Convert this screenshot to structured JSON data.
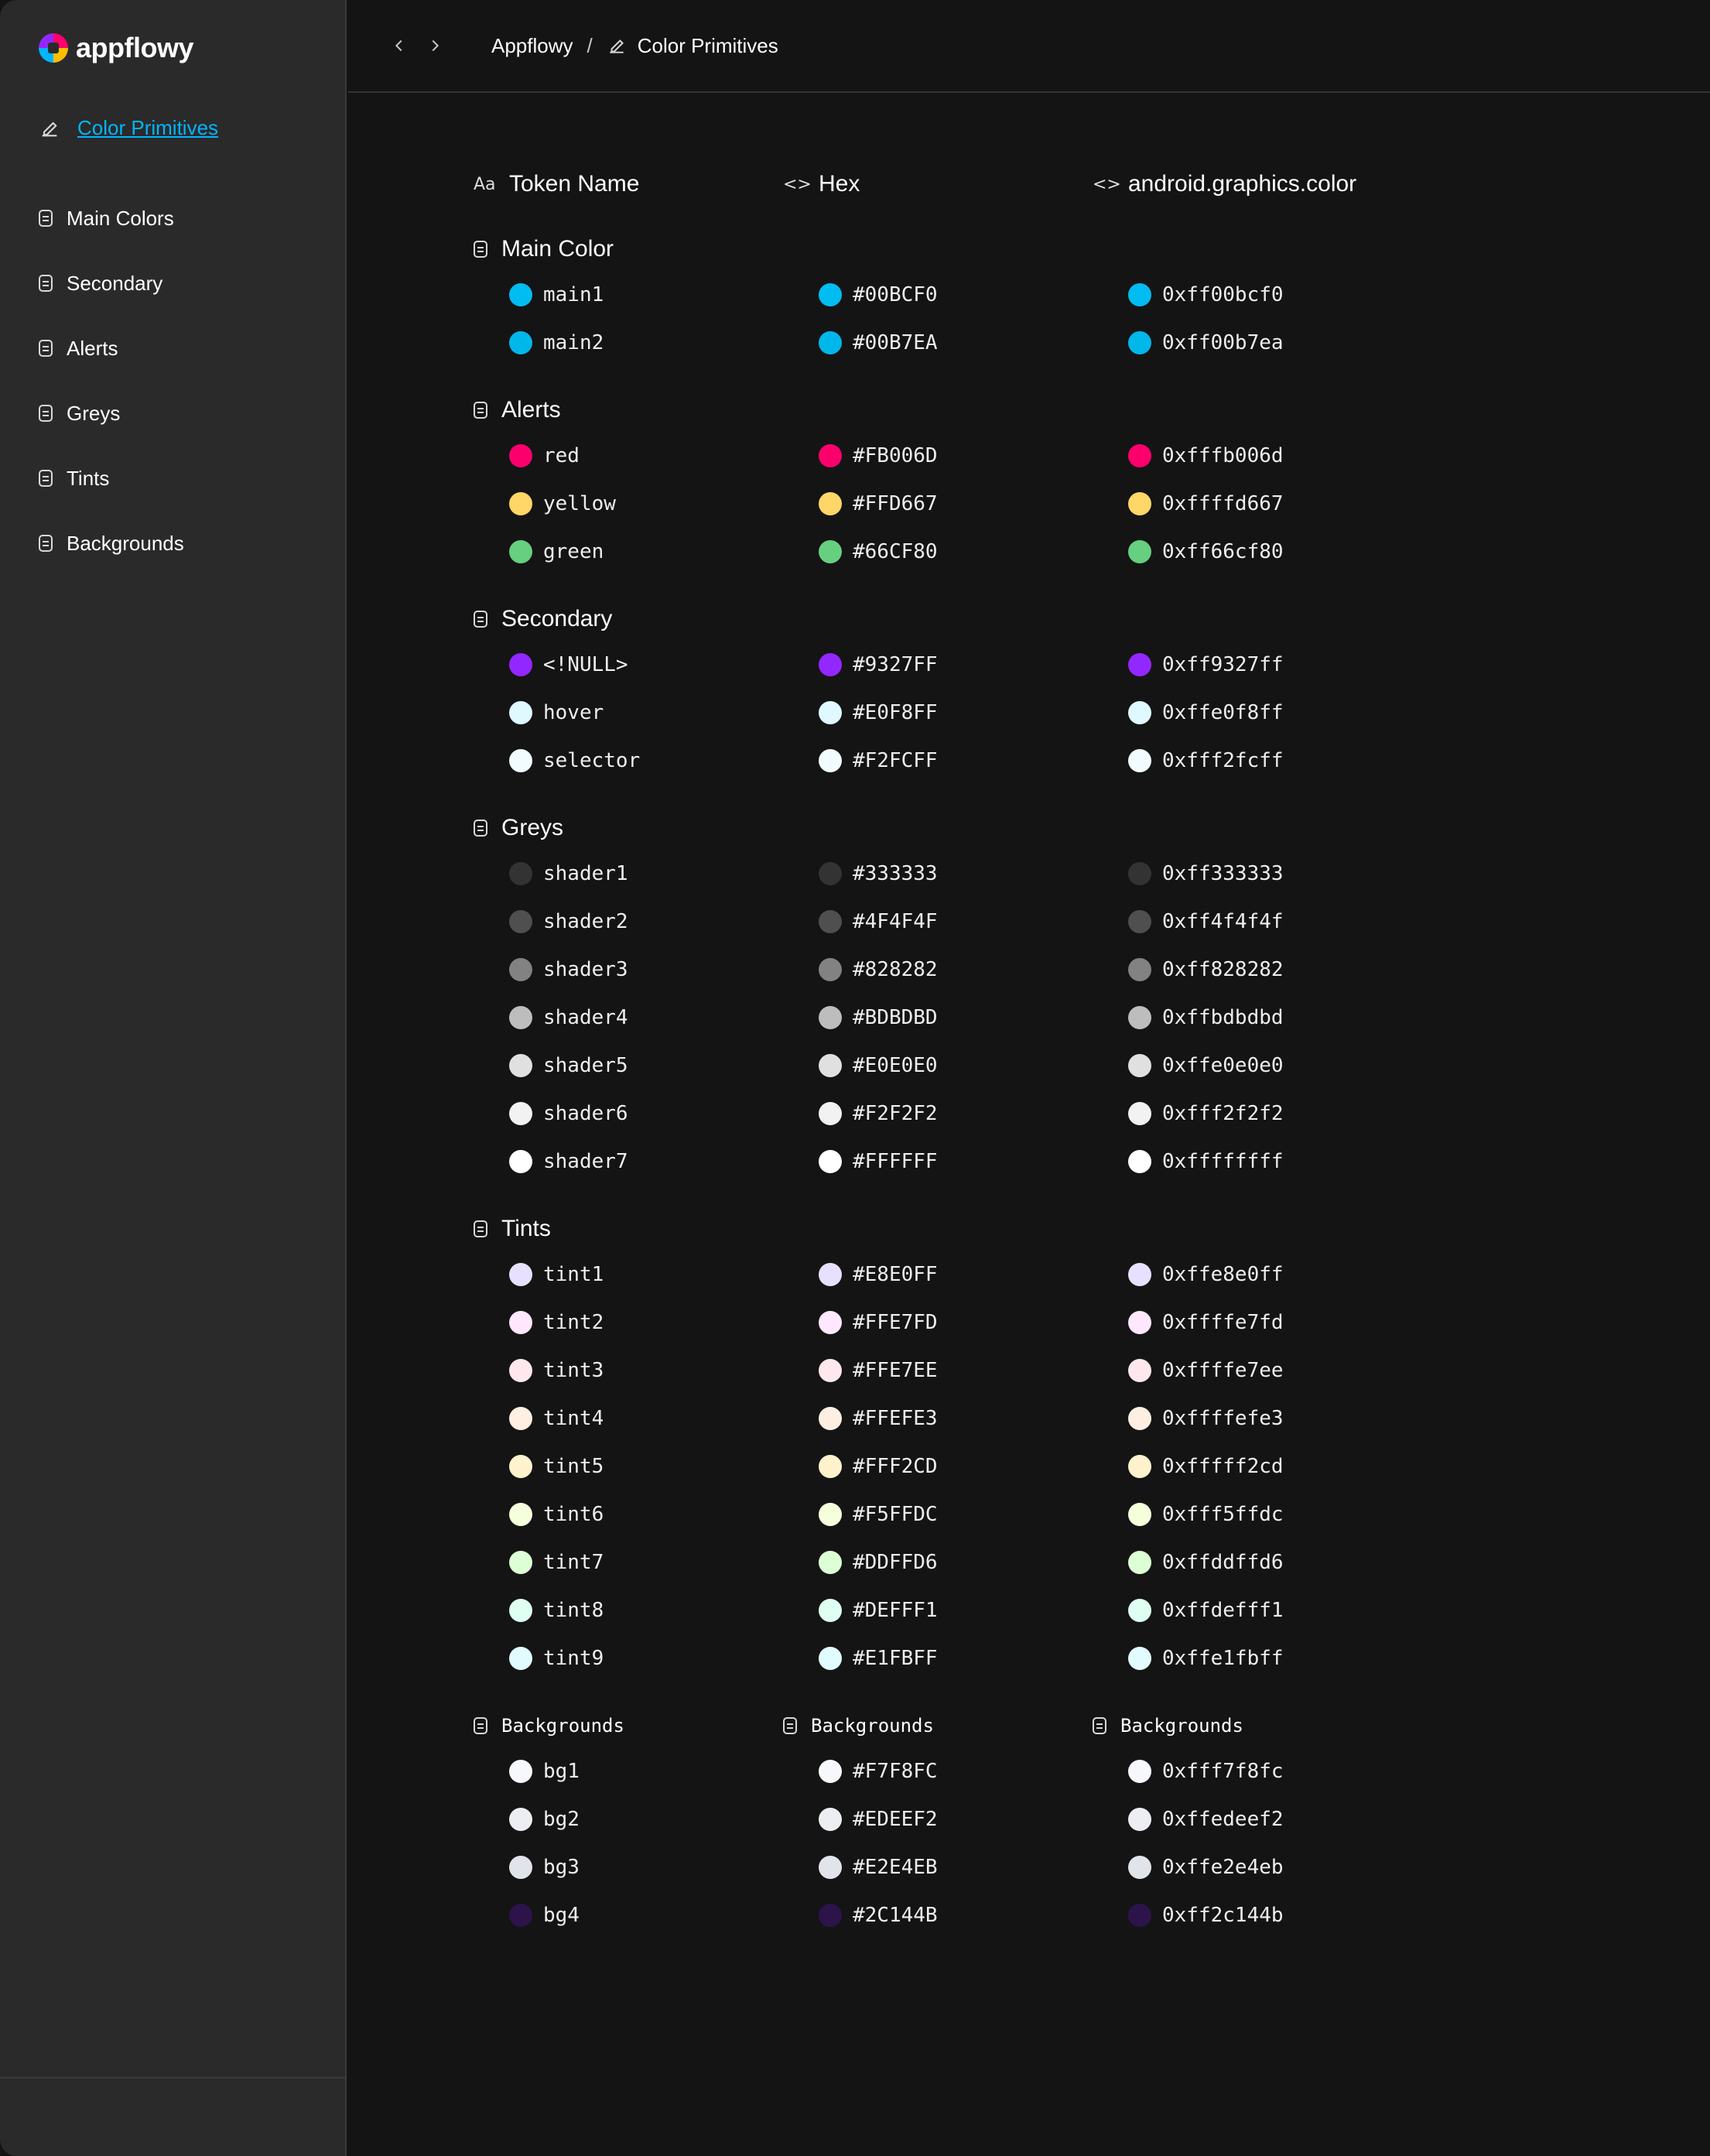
{
  "app": {
    "name": "appflowy"
  },
  "sidebar": {
    "active": "Color Primitives",
    "items": [
      "Main Colors",
      "Secondary",
      "Alerts",
      "Greys",
      "Tints",
      "Backgrounds"
    ]
  },
  "breadcrumb": {
    "root": "Appflowy",
    "separator": "/",
    "current": "Color Primitives"
  },
  "columns": [
    "Token Name",
    "Hex",
    "android.graphics.color"
  ],
  "sections": [
    {
      "title": "Main Color",
      "rows": [
        {
          "name": "main1",
          "hex": "#00BCF0",
          "android": "0xff00bcf0"
        },
        {
          "name": "main2",
          "hex": "#00B7EA",
          "android": "0xff00b7ea"
        }
      ]
    },
    {
      "title": "Alerts",
      "rows": [
        {
          "name": "red",
          "hex": "#FB006D",
          "android": "0xfffb006d"
        },
        {
          "name": "yellow",
          "hex": "#FFD667",
          "android": "0xffffd667"
        },
        {
          "name": "green",
          "hex": "#66CF80",
          "android": "0xff66cf80"
        }
      ]
    },
    {
      "title": "Secondary",
      "rows": [
        {
          "name": "<!NULL>",
          "hex": "#9327FF",
          "android": "0xff9327ff"
        },
        {
          "name": "hover",
          "hex": "#E0F8FF",
          "android": "0xffe0f8ff"
        },
        {
          "name": "selector",
          "hex": "#F2FCFF",
          "android": "0xfff2fcff"
        }
      ]
    },
    {
      "title": "Greys",
      "rows": [
        {
          "name": "shader1",
          "hex": "#333333",
          "android": "0xff333333"
        },
        {
          "name": "shader2",
          "hex": "#4F4F4F",
          "android": "0xff4f4f4f"
        },
        {
          "name": "shader3",
          "hex": "#828282",
          "android": "0xff828282"
        },
        {
          "name": "shader4",
          "hex": "#BDBDBD",
          "android": "0xffbdbdbd"
        },
        {
          "name": "shader5",
          "hex": "#E0E0E0",
          "android": "0xffe0e0e0"
        },
        {
          "name": "shader6",
          "hex": "#F2F2F2",
          "android": "0xfff2f2f2"
        },
        {
          "name": "shader7",
          "hex": "#FFFFFF",
          "android": "0xffffffff"
        }
      ]
    },
    {
      "title": "Tints",
      "rows": [
        {
          "name": "tint1",
          "hex": "#E8E0FF",
          "android": "0xffe8e0ff"
        },
        {
          "name": "tint2",
          "hex": "#FFE7FD",
          "android": "0xffffe7fd"
        },
        {
          "name": "tint3",
          "hex": "#FFE7EE",
          "android": "0xffffe7ee"
        },
        {
          "name": "tint4",
          "hex": "#FFEFE3",
          "android": "0xffffefe3"
        },
        {
          "name": "tint5",
          "hex": "#FFF2CD",
          "android": "0xfffff2cd"
        },
        {
          "name": "tint6",
          "hex": "#F5FFDC",
          "android": "0xfff5ffdc"
        },
        {
          "name": "tint7",
          "hex": "#DDFFD6",
          "android": "0xffddffd6"
        },
        {
          "name": "tint8",
          "hex": "#DEFFF1",
          "android": "0xffdefff1"
        },
        {
          "name": "tint9",
          "hex": "#E1FBFF",
          "android": "0xffe1fbff"
        }
      ]
    },
    {
      "title": "Backgrounds",
      "repeatTitle": true,
      "rows": [
        {
          "name": "bg1",
          "hex": "#F7F8FC",
          "android": "0xfff7f8fc"
        },
        {
          "name": "bg2",
          "hex": "#EDEEF2",
          "android": "0xffedeef2"
        },
        {
          "name": "bg3",
          "hex": "#E2E4EB",
          "android": "0xffe2e4eb"
        },
        {
          "name": "bg4",
          "hex": "#2C144B",
          "android": "0xff2c144b"
        }
      ]
    }
  ]
}
